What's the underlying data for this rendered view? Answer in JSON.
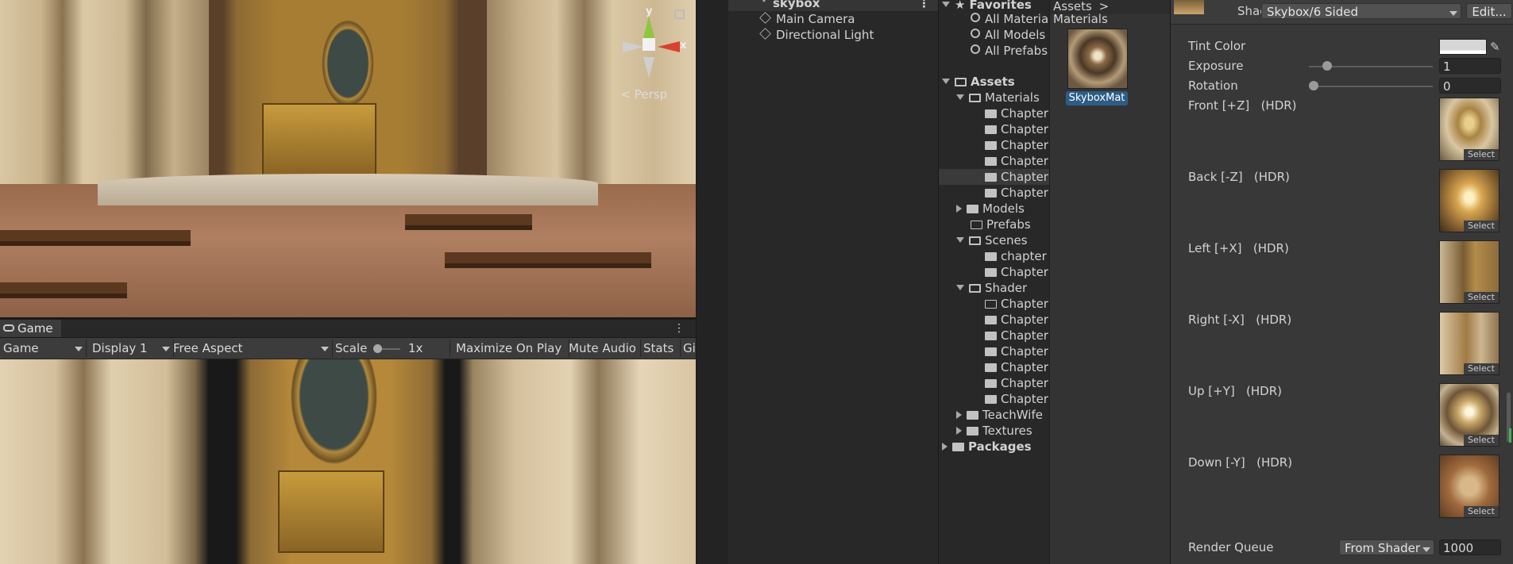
{
  "scene_view": {
    "axis_y": "y",
    "axis_x": "x",
    "projection_label": "Persp"
  },
  "game_view": {
    "tab_label": "Game",
    "toolbar": {
      "mode": "Game",
      "display": "Display 1",
      "aspect": "Free Aspect",
      "scale_label": "Scale",
      "scale_value": "1x",
      "maximize": "Maximize On Play",
      "mute": "Mute Audio",
      "stats": "Stats",
      "gizmos": "Gi"
    }
  },
  "hierarchy": {
    "scene_name": "skybox",
    "items": [
      {
        "label": "Main Camera"
      },
      {
        "label": "Directional Light"
      }
    ]
  },
  "project": {
    "favorites_label": "Favorites",
    "favorites": [
      "All Materia",
      "All Models",
      "All Prefabs"
    ],
    "assets_label": "Assets",
    "materials_label": "Materials",
    "materials_children": [
      "Chapter",
      "Chapter",
      "Chapter",
      "Chapter",
      "Chapter",
      "Chapter"
    ],
    "models_label": "Models",
    "prefabs_label": "Prefabs",
    "scenes_label": "Scenes",
    "scenes_children": [
      "chapter",
      "Chapter"
    ],
    "shader_label": "Shader",
    "shader_children": [
      "Chapter",
      "Chapter",
      "Chapter",
      "Chapter",
      "Chapter",
      "Chapter",
      "Chapter"
    ],
    "teachwife_label": "TeachWife",
    "textures_label": "Textures",
    "packages_label": "Packages",
    "breadcrumb": [
      "Assets",
      "Materials"
    ],
    "breadcrumb_sep": ">",
    "selected_asset": "SkyboxMat"
  },
  "inspector": {
    "shader_label": "Shader",
    "shader_value": "Skybox/6 Sided",
    "edit_button": "Edit...",
    "tint_label": "Tint Color",
    "exposure_label": "Exposure",
    "exposure_value": "1",
    "exposure_level": 0.15,
    "rotation_label": "Rotation",
    "rotation_value": "0",
    "rotation_level": 0.0,
    "faces": [
      {
        "label": "Front [+Z]",
        "hdr": "(HDR)",
        "select": "Select"
      },
      {
        "label": "Back [-Z]",
        "hdr": "(HDR)",
        "select": "Select"
      },
      {
        "label": "Left [+X]",
        "hdr": "(HDR)",
        "select": "Select"
      },
      {
        "label": "Right [-X]",
        "hdr": "(HDR)",
        "select": "Select"
      },
      {
        "label": "Up [+Y]",
        "hdr": "(HDR)",
        "select": "Select"
      },
      {
        "label": "Down [-Y]",
        "hdr": "(HDR)",
        "select": "Select"
      }
    ],
    "render_queue_label": "Render Queue",
    "render_queue_mode": "From Shader",
    "render_queue_value": "1000"
  },
  "colors": {
    "selection": "#2c5d87",
    "x_axis": "#d9412f",
    "y_axis": "#8ec63f",
    "scroll_accent": "#4caf50"
  }
}
